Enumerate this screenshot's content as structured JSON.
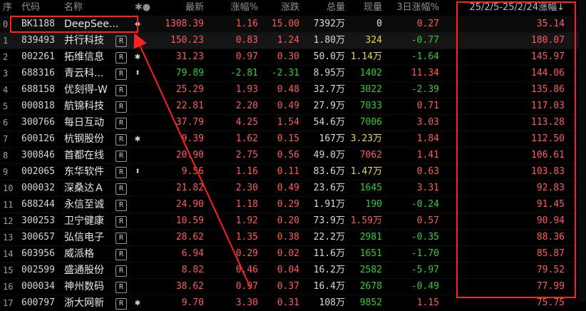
{
  "header": {
    "idx": "序",
    "code": "代码",
    "name": "名称",
    "mark": "✱●",
    "price": "最新",
    "pct": "涨幅%",
    "chg": "涨跌",
    "vol": "总量",
    "cur": "现量",
    "d3": "3日涨幅%",
    "range": "25/2/5-25/2/24涨幅↓"
  },
  "rows": [
    {
      "idx": "0",
      "code": "BK1188",
      "name": "DeepSee...",
      "tag": "",
      "mark": "◆",
      "price": "1308.39",
      "pct": "1.16",
      "chg": "15.00",
      "vol": "7392",
      "unit": "万",
      "cur": "0",
      "d3": "0.27",
      "range": "35.14",
      "price_c": "red",
      "pct_c": "red",
      "chg_c": "red",
      "cur_c": "wht",
      "d3_c": "red"
    },
    {
      "idx": "1",
      "code": "839493",
      "name": "并行科技",
      "tag": "R",
      "mark": "",
      "price": "150.23",
      "pct": "0.83",
      "chg": "1.24",
      "vol": "1.80",
      "unit": "万",
      "cur": "324",
      "d3": "-0.77",
      "range": "180.07",
      "price_c": "red",
      "pct_c": "red",
      "chg_c": "red",
      "cur_c": "yel",
      "d3_c": "grn"
    },
    {
      "idx": "2",
      "code": "002261",
      "name": "拓维信息",
      "tag": "R",
      "mark": "✱",
      "price": "31.23",
      "pct": "0.97",
      "chg": "0.30",
      "vol": "50.0",
      "unit": "万",
      "cur": "1.14万",
      "d3": "-1.64",
      "range": "145.97",
      "price_c": "red",
      "pct_c": "red",
      "chg_c": "red",
      "cur_c": "yel",
      "d3_c": "grn"
    },
    {
      "idx": "3",
      "code": "688316",
      "name": "青云科...",
      "tag": "R",
      "mark": "⬍",
      "price": "79.89",
      "pct": "-2.81",
      "chg": "-2.31",
      "vol": "8.95",
      "unit": "万",
      "cur": "1402",
      "d3": "11.34",
      "range": "144.06",
      "price_c": "grn",
      "pct_c": "grn",
      "chg_c": "grn",
      "cur_c": "grn",
      "d3_c": "red"
    },
    {
      "idx": "4",
      "code": "688158",
      "name": "优刻得-W",
      "tag": "R",
      "mark": "",
      "price": "25.29",
      "pct": "1.93",
      "chg": "0.48",
      "vol": "32.7",
      "unit": "万",
      "cur": "3022",
      "d3": "-2.39",
      "range": "135.86",
      "price_c": "red",
      "pct_c": "red",
      "chg_c": "red",
      "cur_c": "grn",
      "d3_c": "grn"
    },
    {
      "idx": "5",
      "code": "000818",
      "name": "航锦科技",
      "tag": "R",
      "mark": "",
      "price": "22.81",
      "pct": "2.20",
      "chg": "0.49",
      "vol": "27.9",
      "unit": "万",
      "cur": "7033",
      "d3": "0.71",
      "range": "117.03",
      "price_c": "red",
      "pct_c": "red",
      "chg_c": "red",
      "cur_c": "grn",
      "d3_c": "red"
    },
    {
      "idx": "6",
      "code": "300766",
      "name": "每日互动",
      "tag": "R",
      "mark": "",
      "price": "37.79",
      "pct": "4.25",
      "chg": "1.54",
      "vol": "54.6",
      "unit": "万",
      "cur": "7006",
      "d3": "3.03",
      "range": "113.28",
      "price_c": "red",
      "pct_c": "red",
      "chg_c": "red",
      "cur_c": "grn",
      "d3_c": "red"
    },
    {
      "idx": "7",
      "code": "600126",
      "name": "杭钢股份",
      "tag": "R",
      "mark": "✱",
      "price": "9.39",
      "pct": "1.62",
      "chg": "0.15",
      "vol": "167",
      "unit": "万",
      "cur": "3.23万",
      "d3": "1.84",
      "range": "112.50",
      "price_c": "red",
      "pct_c": "red",
      "chg_c": "red",
      "cur_c": "yel",
      "d3_c": "red"
    },
    {
      "idx": "8",
      "code": "300846",
      "name": "首都在线",
      "tag": "R",
      "mark": "",
      "price": "20.90",
      "pct": "2.75",
      "chg": "0.56",
      "vol": "49.0",
      "unit": "万",
      "cur": "7062",
      "d3": "1.41",
      "range": "106.61",
      "price_c": "red",
      "pct_c": "red",
      "chg_c": "red",
      "cur_c": "red",
      "d3_c": "red"
    },
    {
      "idx": "9",
      "code": "002065",
      "name": "东华软件",
      "tag": "R",
      "mark": "⬍",
      "price": "9.56",
      "pct": "1.16",
      "chg": "0.11",
      "vol": "83.6",
      "unit": "万",
      "cur": "1.47万",
      "d3": "0.63",
      "range": "103.83",
      "price_c": "red",
      "pct_c": "red",
      "chg_c": "red",
      "cur_c": "yel",
      "d3_c": "red"
    },
    {
      "idx": "10",
      "code": "000032",
      "name": "深桑达Ａ",
      "tag": "R",
      "mark": "",
      "price": "21.82",
      "pct": "2.30",
      "chg": "0.49",
      "vol": "23.6",
      "unit": "万",
      "cur": "1645",
      "d3": "3.31",
      "range": "92.83",
      "price_c": "red",
      "pct_c": "red",
      "chg_c": "red",
      "cur_c": "grn",
      "d3_c": "red"
    },
    {
      "idx": "11",
      "code": "688244",
      "name": "永信至诚",
      "tag": "R",
      "mark": "",
      "price": "24.90",
      "pct": "1.18",
      "chg": "0.29",
      "vol": "1.91",
      "unit": "万",
      "cur": "190",
      "d3": "-0.24",
      "range": "91.45",
      "price_c": "red",
      "pct_c": "red",
      "chg_c": "red",
      "cur_c": "grn",
      "d3_c": "grn"
    },
    {
      "idx": "12",
      "code": "300253",
      "name": "卫宁健康",
      "tag": "R",
      "mark": "",
      "price": "10.59",
      "pct": "1.92",
      "chg": "0.20",
      "vol": "73.9",
      "unit": "万",
      "cur": "1.59万",
      "d3": "0.57",
      "range": "90.94",
      "price_c": "red",
      "pct_c": "red",
      "chg_c": "red",
      "cur_c": "red",
      "d3_c": "red"
    },
    {
      "idx": "13",
      "code": "300657",
      "name": "弘信电子",
      "tag": "R",
      "mark": "",
      "price": "28.62",
      "pct": "1.35",
      "chg": "0.38",
      "vol": "22.2",
      "unit": "万",
      "cur": "2981",
      "d3": "-0.35",
      "range": "88.36",
      "price_c": "red",
      "pct_c": "red",
      "chg_c": "red",
      "cur_c": "grn",
      "d3_c": "grn"
    },
    {
      "idx": "14",
      "code": "603956",
      "name": "威派格",
      "tag": "R",
      "mark": "",
      "price": "6.94",
      "pct": "0.29",
      "chg": "0.02",
      "vol": "11.6",
      "unit": "万",
      "cur": "1651",
      "d3": "-1.70",
      "range": "85.87",
      "price_c": "red",
      "pct_c": "red",
      "chg_c": "red",
      "cur_c": "grn",
      "d3_c": "grn"
    },
    {
      "idx": "15",
      "code": "002599",
      "name": "盛通股份",
      "tag": "R",
      "mark": "",
      "price": "8.82",
      "pct": "0.46",
      "chg": "0.04",
      "vol": "16.2",
      "unit": "万",
      "cur": "2582",
      "d3": "-5.97",
      "range": "79.52",
      "price_c": "red",
      "pct_c": "red",
      "chg_c": "red",
      "cur_c": "grn",
      "d3_c": "grn"
    },
    {
      "idx": "16",
      "code": "000034",
      "name": "神州数码",
      "tag": "R",
      "mark": "",
      "price": "38.62",
      "pct": "0.97",
      "chg": "0.37",
      "vol": "16.4",
      "unit": "万",
      "cur": "2678",
      "d3": "-0.49",
      "range": "77.99",
      "price_c": "red",
      "pct_c": "red",
      "chg_c": "red",
      "cur_c": "grn",
      "d3_c": "grn"
    },
    {
      "idx": "17",
      "code": "600797",
      "name": "浙大网新",
      "tag": "R",
      "mark": "✱",
      "price": "9.70",
      "pct": "3.30",
      "chg": "0.31",
      "vol": "108",
      "unit": "万",
      "cur": "9852",
      "d3": "1.15",
      "range": "75.75",
      "price_c": "red",
      "pct_c": "red",
      "chg_c": "red",
      "cur_c": "grn",
      "d3_c": "red"
    }
  ],
  "colors": {
    "red": "#ff5b5b",
    "green": "#33cc33",
    "yellow": "#e6d94a",
    "annotation": "#ff2020",
    "background": "#000000"
  }
}
